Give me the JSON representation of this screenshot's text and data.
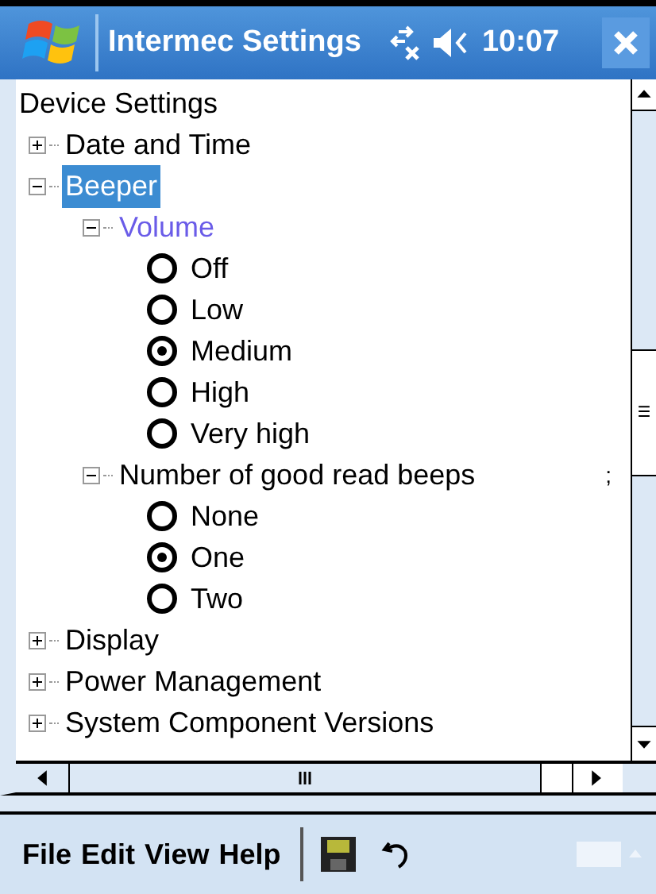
{
  "title_bar": {
    "title": "Intermec Settings",
    "time": "10:07"
  },
  "tree": {
    "label": "Device Settings",
    "children": [
      {
        "kind": "group",
        "label": "Date and Time",
        "expanded": false,
        "selected": false
      },
      {
        "kind": "group",
        "label": "Beeper",
        "expanded": true,
        "selected": true,
        "children": [
          {
            "kind": "group",
            "label": "Volume",
            "expanded": true,
            "selected": false,
            "highlighted": true,
            "children": [
              {
                "kind": "option",
                "label": "Off",
                "selected": false
              },
              {
                "kind": "option",
                "label": "Low",
                "selected": false
              },
              {
                "kind": "option",
                "label": "Medium",
                "selected": true
              },
              {
                "kind": "option",
                "label": "High",
                "selected": false
              },
              {
                "kind": "option",
                "label": "Very high",
                "selected": false
              }
            ]
          },
          {
            "kind": "group",
            "label": "Number of good read beeps",
            "expanded": true,
            "selected": false,
            "highlighted": false,
            "suffix": ";",
            "children": [
              {
                "kind": "option",
                "label": "None",
                "selected": false
              },
              {
                "kind": "option",
                "label": "One",
                "selected": true
              },
              {
                "kind": "option",
                "label": "Two",
                "selected": false
              }
            ]
          }
        ]
      },
      {
        "kind": "group",
        "label": "Display",
        "expanded": false,
        "selected": false
      },
      {
        "kind": "group",
        "label": "Power Management",
        "expanded": false,
        "selected": false
      },
      {
        "kind": "group",
        "label": "System Component Versions",
        "expanded": false,
        "selected": false
      }
    ]
  },
  "menu_bar": [
    "File",
    "Edit",
    "View",
    "Help"
  ]
}
